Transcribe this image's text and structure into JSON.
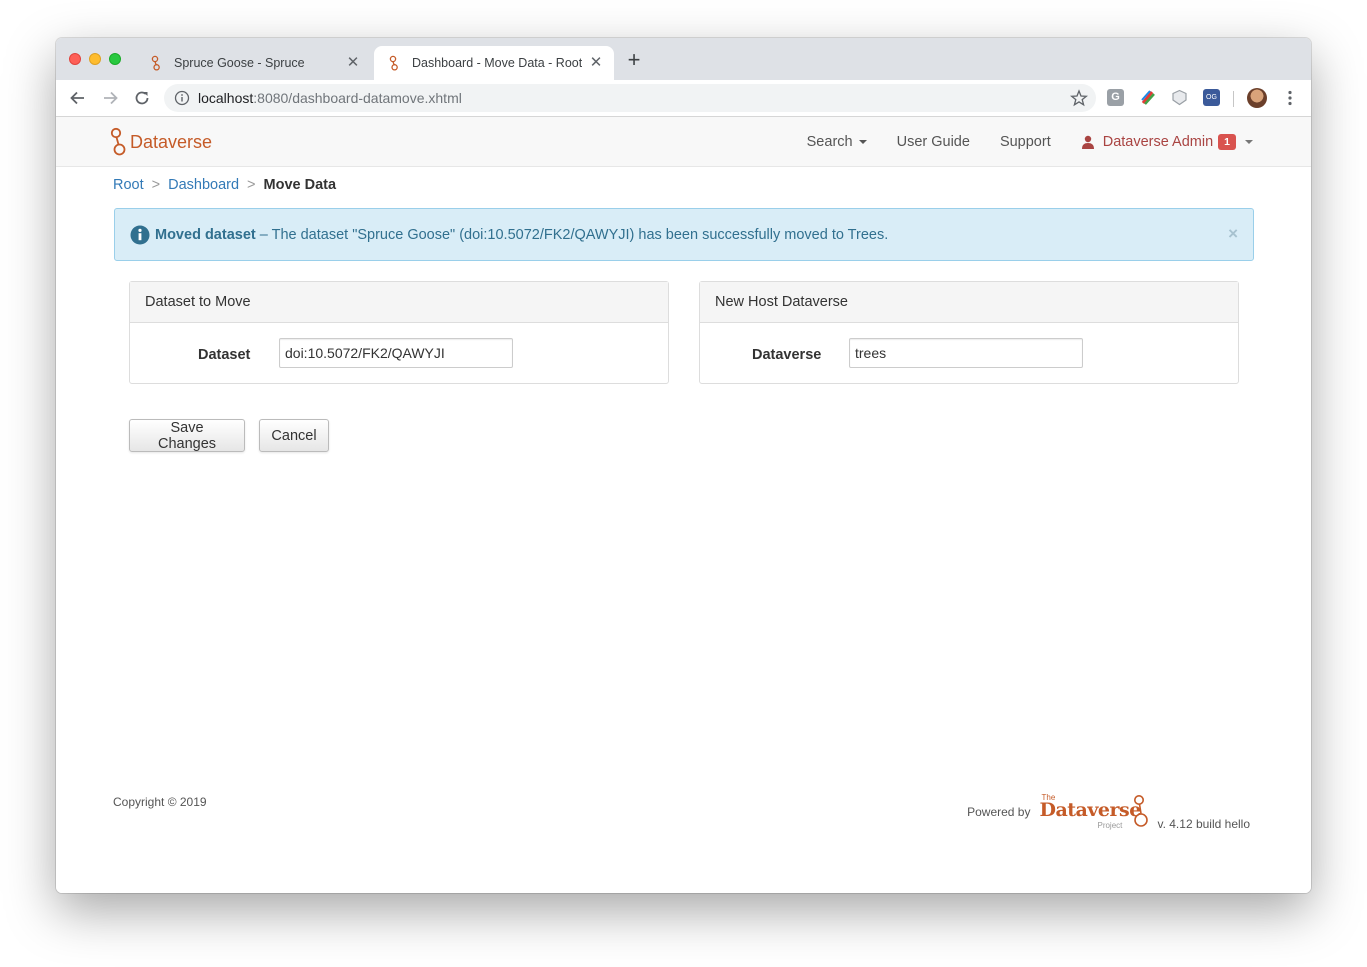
{
  "browser": {
    "tabs": [
      {
        "title": "Spruce Goose - Spruce"
      },
      {
        "title": "Dashboard - Move Data - Root"
      }
    ],
    "url_host": "localhost",
    "url_path": ":8080/dashboard-datamove.xhtml"
  },
  "navbar": {
    "brand": "Dataverse",
    "search_label": "Search",
    "user_guide_label": "User Guide",
    "support_label": "Support",
    "user_label": "Dataverse Admin",
    "notification_count": "1"
  },
  "breadcrumb": {
    "root": "Root",
    "dashboard": "Dashboard",
    "current": "Move Data"
  },
  "alert": {
    "heading": "Moved dataset",
    "message": " – The dataset \"Spruce Goose\" (doi:10.5072/FK2/QAWYJI) has been successfully moved to Trees.",
    "close": "×"
  },
  "panels": {
    "dataset": {
      "heading": "Dataset to Move",
      "label": "Dataset",
      "value": "doi:10.5072/FK2/QAWYJI"
    },
    "host": {
      "heading": "New Host Dataverse",
      "label": "Dataverse",
      "value": "trees"
    }
  },
  "buttons": {
    "save": "Save Changes",
    "cancel": "Cancel"
  },
  "footer": {
    "copyright": "Copyright © 2019",
    "powered_by": "Powered by",
    "logo_the": "The",
    "logo_name": "Dataverse",
    "logo_project": "Project",
    "version": "v. 4.12 build hello"
  },
  "colors": {
    "brand": "#c55b28",
    "link": "#337ab7",
    "alert_bg": "#d9edf7",
    "alert_text": "#31708f",
    "badge": "#d9534f"
  }
}
